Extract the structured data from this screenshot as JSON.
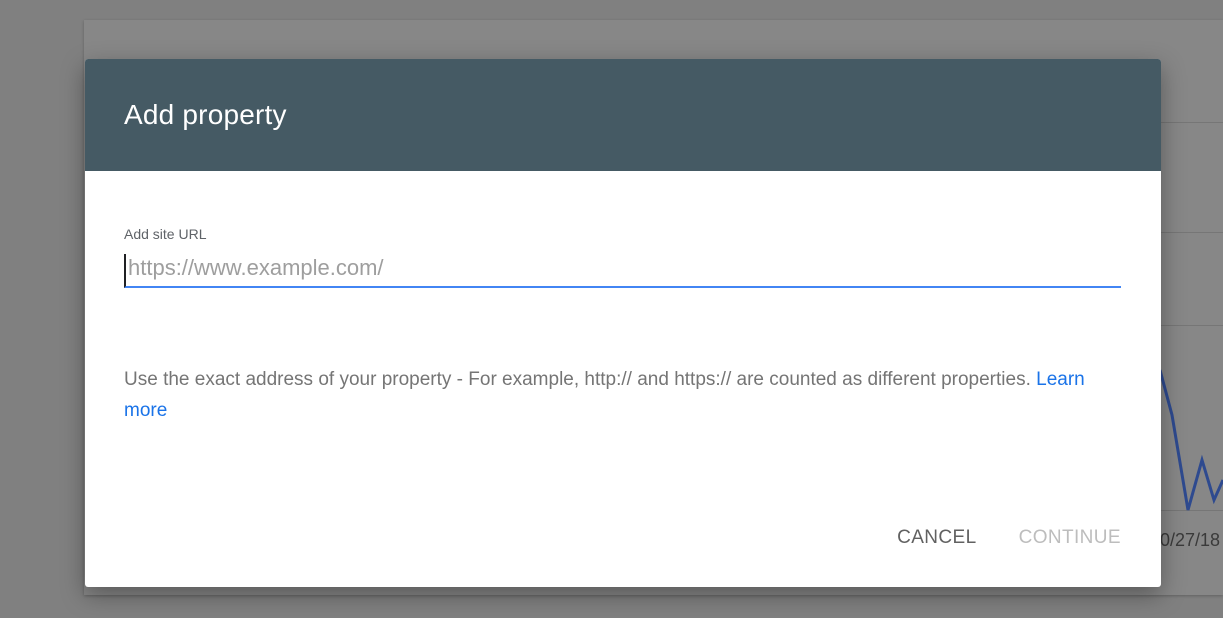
{
  "dialog": {
    "title": "Add property",
    "field_label": "Add site URL",
    "input_value": "",
    "input_placeholder": "https://www.example.com/",
    "help_text": "Use the exact address of your property - For example, http:// and https:// are counted as different properties. ",
    "learn_more_label": "Learn more",
    "cancel_label": "CANCEL",
    "continue_label": "CONTINUE"
  },
  "background": {
    "date_fragment": "0/27/18"
  },
  "colors": {
    "header": "#455a64",
    "accent": "#4285f4",
    "link": "#1a73e8",
    "overlay": "#808080"
  }
}
